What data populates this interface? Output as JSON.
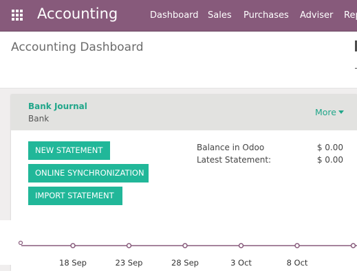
{
  "navbar": {
    "title": "Accounting",
    "menu": [
      "Dashboard",
      "Sales",
      "Purchases",
      "Adviser",
      "Rep"
    ]
  },
  "control_panel": {
    "title": "Accounting Dashboard"
  },
  "journal": {
    "name": "Bank Journal",
    "type": "Bank",
    "more_label": "More",
    "buttons": {
      "new_statement": "NEW STATEMENT",
      "online_sync": "ONLINE SYNCHRONIZATION",
      "import_statement": "IMPORT STATEMENT"
    },
    "balance": {
      "odoo_label": "Balance in Odoo",
      "odoo_value": "$ 0.00",
      "statement_label": "Latest Statement:",
      "statement_value": "$ 0.00"
    }
  },
  "chart_data": {
    "type": "line",
    "x": [
      "18 Sep",
      "23 Sep",
      "28 Sep",
      "3 Oct",
      "8 Oct"
    ],
    "values": [
      0,
      0,
      0,
      0,
      0
    ],
    "line_color": "#875a7b"
  },
  "colors": {
    "brand": "#875a7b",
    "accent": "#21b799",
    "link": "#21a68a"
  }
}
